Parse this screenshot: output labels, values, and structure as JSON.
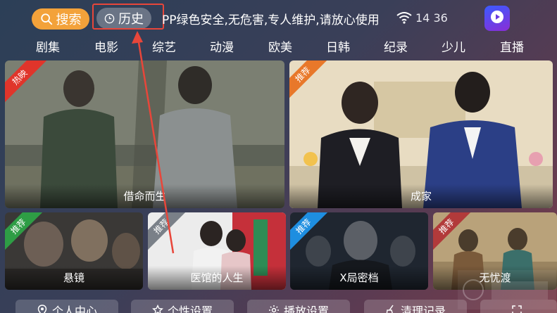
{
  "topbar": {
    "search_label": "搜索",
    "history_label": "历史",
    "marquee_text": "PP绿色安全,无危害,专人维护,请放心使用",
    "time": "14 36"
  },
  "nav": {
    "tabs": [
      "剧集",
      "电影",
      "综艺",
      "动漫",
      "欧美",
      "日韩",
      "纪录",
      "少儿",
      "直播"
    ]
  },
  "cards": [
    {
      "badge": "热映",
      "title": "借命而生"
    },
    {
      "badge": "推荐",
      "title": "成家"
    },
    {
      "badge": "推荐",
      "title": "悬镜"
    },
    {
      "badge": "推荐",
      "title": "医馆的人生"
    },
    {
      "badge": "推荐",
      "title": "X局密档"
    },
    {
      "badge": "推荐",
      "title": "无忧渡"
    }
  ],
  "bottom": {
    "buttons": [
      "个人中心",
      "个性设置",
      "播放设置",
      "清理记录"
    ]
  },
  "colors": {
    "search_orange": "#f3a23a",
    "highlight_red": "#e8463a"
  }
}
